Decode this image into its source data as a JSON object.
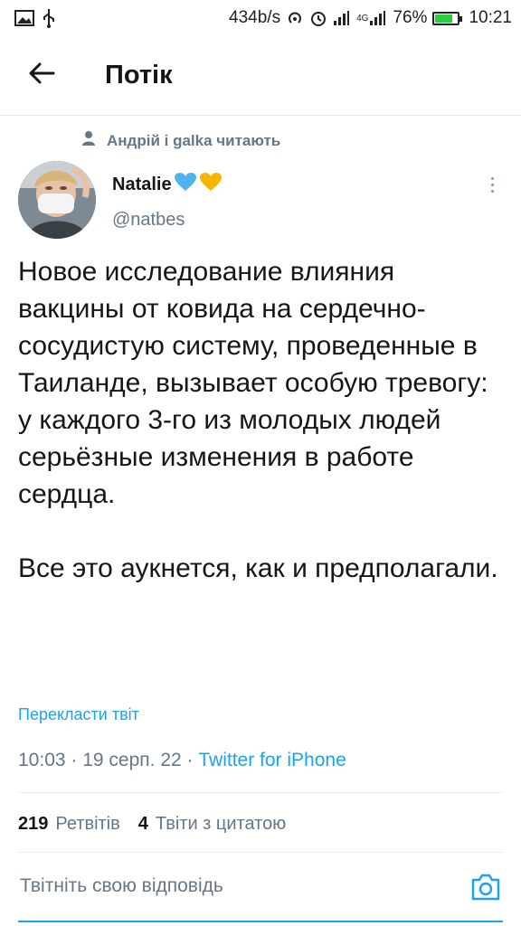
{
  "status_bar": {
    "net_speed": "434b/s",
    "net_type": "4G",
    "battery": "76%",
    "battery_level": 0.76,
    "time": "10:21",
    "icons": [
      "image-icon",
      "usb-icon",
      "hotspot-icon",
      "alarm-icon",
      "signal-icon",
      "signal-4g-icon",
      "battery-icon"
    ]
  },
  "header": {
    "back_icon": "arrow-left-icon",
    "title": "Потік"
  },
  "tweet": {
    "social_context": "Андрій і galka читають",
    "social_icon": "person-icon",
    "author_name": "Natalie",
    "name_emojis": [
      "blue-heart-icon",
      "yellow-heart-icon"
    ],
    "author_handle": "@natbes",
    "paragraph1": "Новое исследование влияния вакцины от ковида на сердечно-сосудистую систему, проведенные в Таиланде, вызывает особую тревогу: у каждого 3-го из молодых людей серьёзные изменения в работе сердца.",
    "paragraph2": "Все это аукнется, как и предполагали.",
    "translate": "Перекласти твіт",
    "time": "10:03",
    "date": "19 серп. 22",
    "source": "Twitter for iPhone",
    "retweets_count": "219",
    "retweets_label": "Ретвітів",
    "quotes_count": "4",
    "quotes_label": "Твіти з цитатою"
  },
  "reply": {
    "placeholder": "Твітніть свою відповідь",
    "camera_icon": "camera-icon"
  },
  "colors": {
    "accent": "#1da1f2",
    "secondary_text": "#657786",
    "divider": "#e6ecf0",
    "heart_blue": "#4fb3f0",
    "heart_yellow": "#f5b400"
  }
}
